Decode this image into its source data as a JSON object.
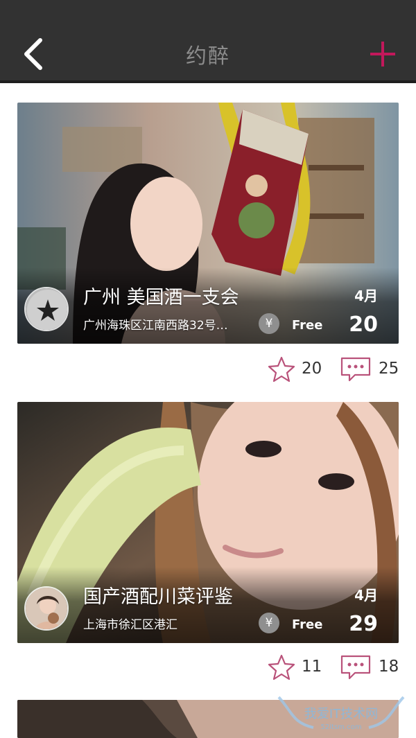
{
  "header": {
    "title": "约醉"
  },
  "events": [
    {
      "title": "广州 美国酒一支会",
      "address": "广州海珠区江南西路32号…",
      "price": "Free",
      "currency_icon": "yen-icon",
      "month": "4月",
      "day": "20",
      "stars": "20",
      "comments": "25"
    },
    {
      "title": "国产酒配川菜评鉴",
      "address": "上海市徐汇区港汇",
      "price": "Free",
      "currency_icon": "yen-icon",
      "month": "4月",
      "day": "29",
      "stars": "11",
      "comments": "18"
    }
  ],
  "colors": {
    "header_bg": "#323232",
    "accent": "#c2185b",
    "icon_pink": "#b9527a"
  },
  "watermark": {
    "text": "我爱IT技术网",
    "url": "52itsm.com"
  }
}
